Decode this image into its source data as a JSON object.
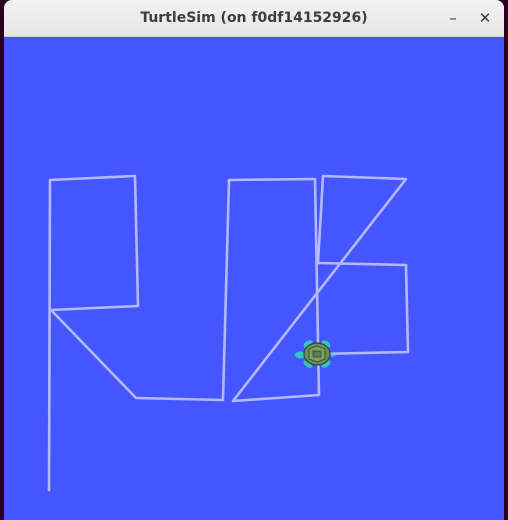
{
  "window": {
    "title": "TurtleSim (on f0df14152926)",
    "minimize_glyph": "–",
    "close_glyph": "✕"
  },
  "canvas": {
    "background_color": "#4556ff",
    "pen_color": "#b3b8ff",
    "turtle_shell_color": "#6b8f5a",
    "turtle_body_color": "#33c9c4"
  },
  "icons": {
    "minimize": "minimize-icon",
    "close": "close-icon",
    "turtle": "turtle-icon"
  }
}
